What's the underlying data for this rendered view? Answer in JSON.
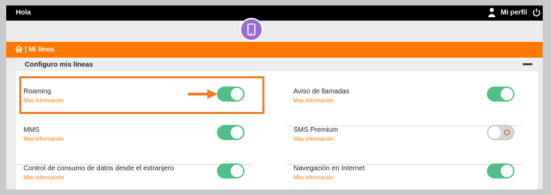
{
  "topbar": {
    "greeting": "Hola",
    "profile_label": "Mi perfil"
  },
  "breadcrumb": {
    "title": "| Mi línea"
  },
  "section": {
    "title": "Configuro mis líneas"
  },
  "settings": [
    {
      "label": "Roaming",
      "more": "Más información",
      "enabled": true
    },
    {
      "label": "Aviso de llamadas",
      "more": "Más información",
      "enabled": true
    },
    {
      "label": "MMS",
      "more": "Más información",
      "enabled": true
    },
    {
      "label": "SMS Premium",
      "more": "Más información",
      "enabled": false
    },
    {
      "label": "Control de consumo de datos desde el extranjero",
      "more": "Más información",
      "enabled": true
    },
    {
      "label": "Navegación en Internet",
      "more": "Más información",
      "enabled": true
    }
  ],
  "colors": {
    "accent": "#ff7900",
    "toggle_on": "#50be87",
    "toggle_off": "#d5d5d5",
    "device_circle": "#9b6bd1"
  },
  "icons": [
    "user-icon",
    "power-icon",
    "smartphone-icon",
    "home-icon",
    "collapse-icon",
    "arrow-icon"
  ]
}
